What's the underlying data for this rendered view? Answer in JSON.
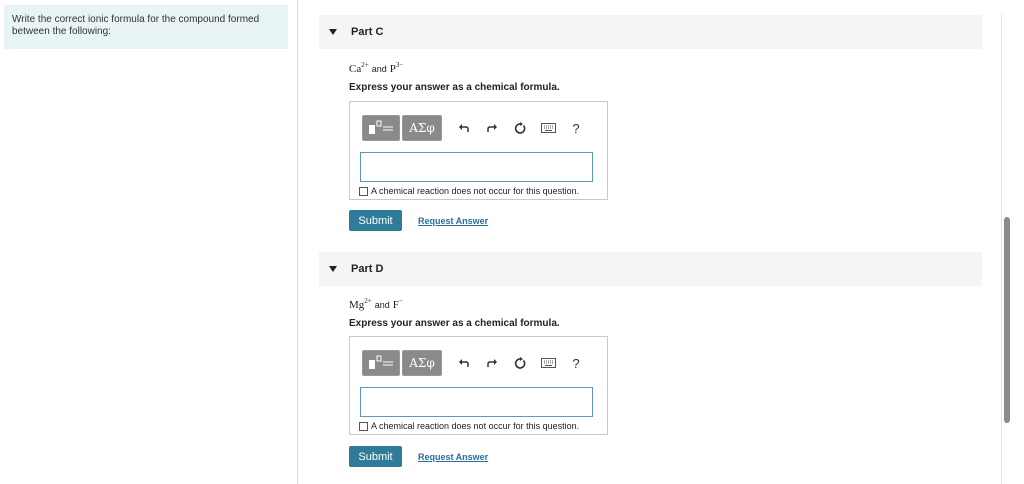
{
  "instructions": "Write the correct ionic formula for the compound formed between the following:",
  "parts": [
    {
      "title": "Part C",
      "cation": {
        "symbol": "Ca",
        "charge": "2+"
      },
      "anion": {
        "symbol": "P",
        "charge": "3−"
      },
      "and_word": "and",
      "prompt": "Express your answer as a chemical formula.",
      "answer_value": "",
      "no_reaction_label": "A chemical reaction does not occur for this question.",
      "submit_label": "Submit",
      "request_label": "Request Answer"
    },
    {
      "title": "Part D",
      "cation": {
        "symbol": "Mg",
        "charge": "2+"
      },
      "anion": {
        "symbol": "F",
        "charge": "−"
      },
      "and_word": "and",
      "prompt": "Express your answer as a chemical formula.",
      "answer_value": "",
      "no_reaction_label": "A chemical reaction does not occur for this question.",
      "submit_label": "Submit",
      "request_label": "Request Answer"
    }
  ],
  "toolbar": {
    "greek_label": "ΑΣφ",
    "help_label": "?",
    "icons": [
      "template-icon",
      "undo-icon",
      "redo-icon",
      "reset-icon",
      "keyboard-icon",
      "help-icon"
    ]
  },
  "colors": {
    "accent": "#2f7b9a",
    "link": "#2a6f9b",
    "instruction_bg": "#e9f4f6"
  }
}
